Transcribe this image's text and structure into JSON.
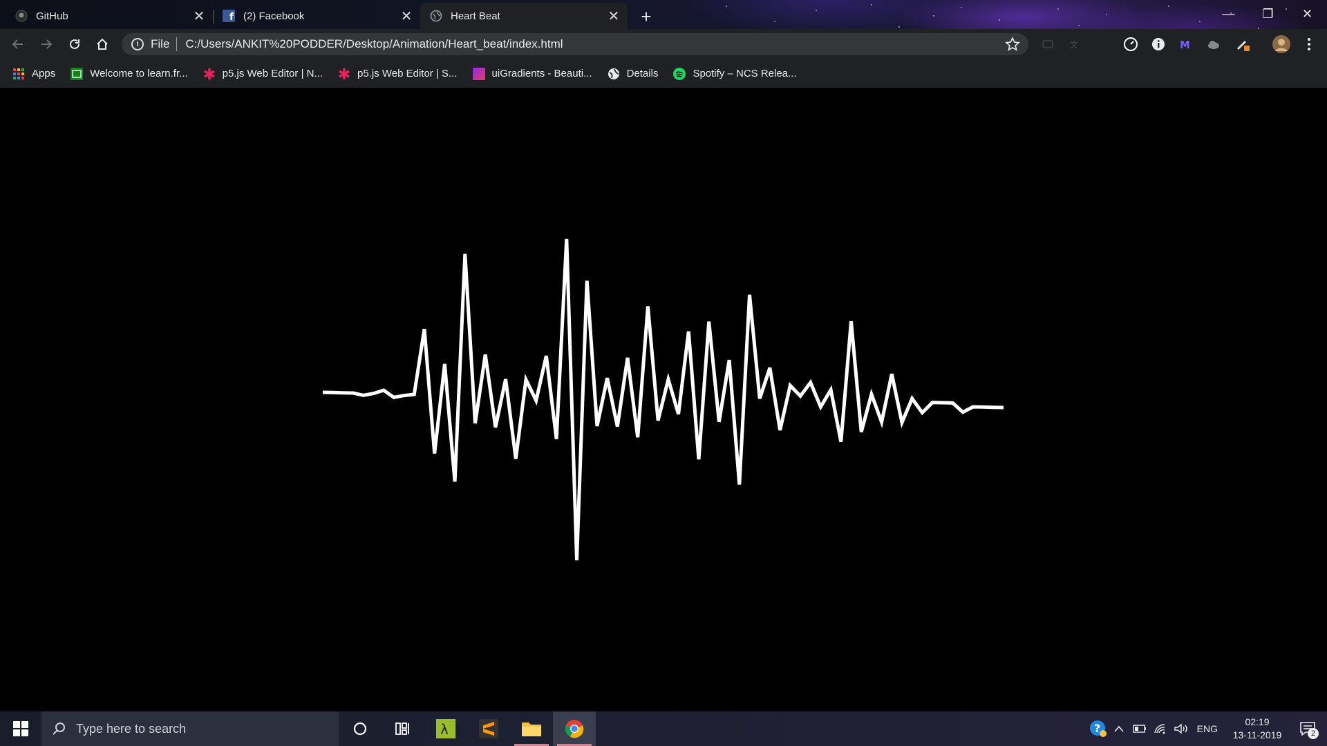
{
  "browser": {
    "tabs": [
      {
        "title": "GitHub",
        "active": false,
        "icon": "github-icon"
      },
      {
        "title": "(2) Facebook",
        "active": false,
        "icon": "facebook-icon"
      },
      {
        "title": "Heart Beat",
        "active": true,
        "icon": "globe-icon"
      }
    ],
    "close_glyph": "✕",
    "new_tab_glyph": "+",
    "window_controls": {
      "minimize": "—",
      "restore": "❐",
      "close": "✕"
    },
    "omnibox": {
      "scheme_label": "File",
      "url": "C:/Users/ANKIT%20PODDER/Desktop/Animation/Heart_beat/index.html"
    },
    "bookmarks": [
      {
        "label": "Apps",
        "icon": "apps-grid-icon"
      },
      {
        "label": "Welcome to learn.fr...",
        "icon": "learn-icon"
      },
      {
        "label": "p5.js Web Editor | N...",
        "icon": "p5-asterisk-icon"
      },
      {
        "label": "p5.js Web Editor | S...",
        "icon": "p5-asterisk-icon"
      },
      {
        "label": "uiGradients - Beauti...",
        "icon": "uigradients-icon"
      },
      {
        "label": "Details",
        "icon": "globe-icon"
      },
      {
        "label": "Spotify – NCS Relea...",
        "icon": "spotify-icon"
      }
    ]
  },
  "page": {
    "background": "#000000",
    "line_color": "#ffffff",
    "waveform": {
      "type": "line",
      "description_values": [
        0,
        0,
        0,
        0,
        -3,
        0,
        5,
        -5,
        -2,
        0,
        95,
        -85,
        45,
        -125,
        205,
        -40,
        60,
        -45,
        25,
        -90,
        25,
        -5,
        60,
        -60,
        230,
        -235,
        170,
        -40,
        30,
        -40,
        60,
        -55,
        135,
        -30,
        30,
        -20,
        100,
        -85,
        115,
        -30,
        60,
        -120,
        155,
        5,
        50,
        -40,
        25,
        10,
        30,
        -5,
        20,
        -55,
        120,
        -40,
        15,
        -25,
        45,
        -25,
        10,
        -10,
        5,
        5,
        5,
        -8,
        0,
        0,
        0,
        0
      ]
    }
  },
  "taskbar": {
    "search_placeholder": "Type here to search",
    "language": "ENG",
    "time": "02:19",
    "date": "13-11-2019",
    "notification_count": "2"
  },
  "colors": {
    "tab_active": "#202124",
    "omnibox": "#35363a",
    "taskbar_running_indicator": "#e07a8a"
  }
}
